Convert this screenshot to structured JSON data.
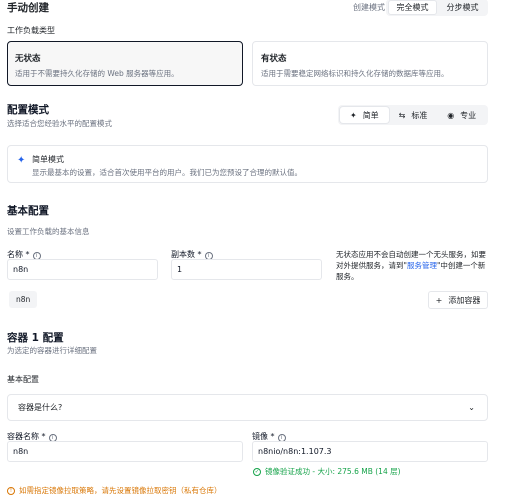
{
  "header": {
    "title": "手动创建",
    "mode_label": "创建模式",
    "mode_full": "完全模式",
    "mode_step": "分步模式"
  },
  "workload": {
    "label": "工作负载类型",
    "stateless_title": "无状态",
    "stateless_desc": "适用于不需要持久化存储的 Web 服务器等应用。",
    "stateful_title": "有状态",
    "stateful_desc": "适用于需要稳定网络标识和持久化存储的数据库等应用。"
  },
  "config_mode": {
    "title": "配置模式",
    "subtitle": "选择适合您经验水平的配置模式",
    "options": [
      "简单",
      "标准",
      "专业"
    ],
    "selected": "简单",
    "simple_title": "简单模式",
    "simple_desc": "显示最基本的设置，适合首次使用平台的用户。我们已为您预设了合理的默认值。"
  },
  "basic": {
    "title": "基本配置",
    "subtitle": "设置工作负载的基本信息",
    "name_label": "名称 *",
    "name_value": "n8n",
    "replicas_label": "副本数 *",
    "replicas_value": "1",
    "note_1": "无状态应用不会自动创建一个无头服务，如要对外提供服务，请到\"",
    "note_link": "服务管理",
    "note_2": "\"中创建一个新服务。",
    "container_chip": "n8n",
    "add_container": "添加容器"
  },
  "container": {
    "title": "容器 1 配置",
    "subtitle": "为选定的容器进行详细配置",
    "basic_label": "基本配置",
    "question": "容器是什么?",
    "name_label": "容器名称 *",
    "name_value": "n8n",
    "image_label": "镜像 *",
    "image_value": "n8nio/n8n:1.107.3",
    "image_status": "镜像验证成功 - 大小: 275.6 MB (14 层)",
    "warning": "如需指定镜像拉取策略，请先设置镜像拉取密钥（私有仓库）"
  },
  "colors": {
    "accent": "#2563eb",
    "success": "#16a34a",
    "warning": "#d97706",
    "selected_border": "#111827"
  }
}
